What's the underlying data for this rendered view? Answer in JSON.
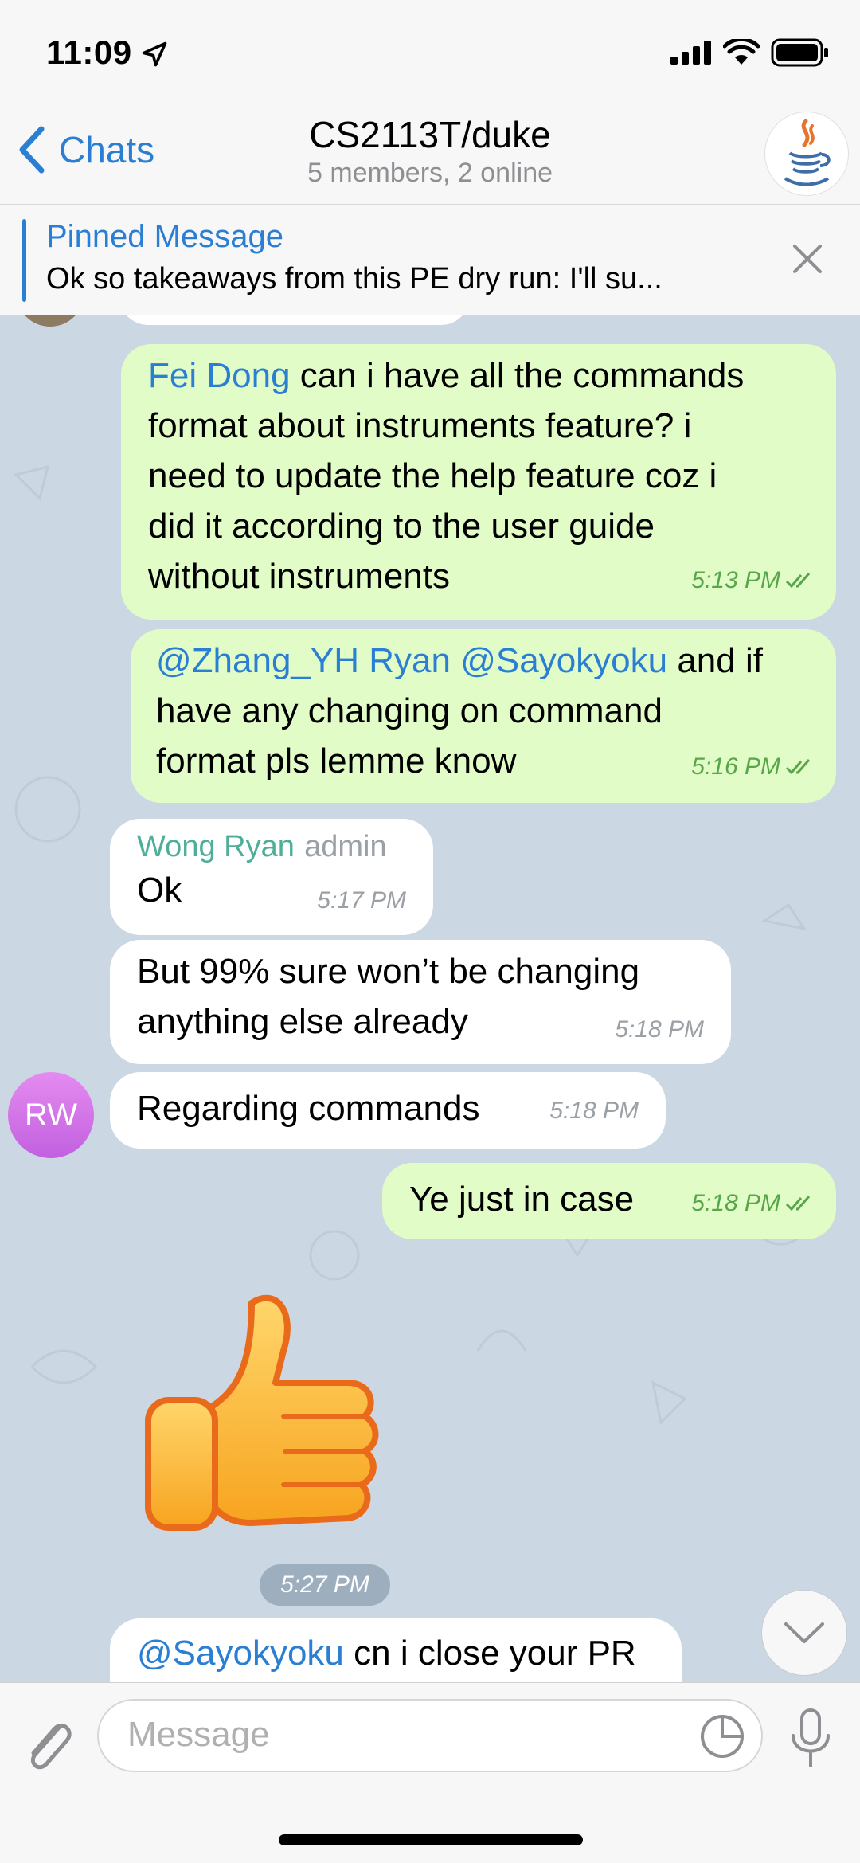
{
  "status_bar": {
    "time": "11:09"
  },
  "nav": {
    "back_label": "Chats",
    "title": "CS2113T/duke",
    "subtitle": "5 members, 2 online"
  },
  "pinned": {
    "title": "Pinned Message",
    "text": "Ok so takeaways from this PE dry run: I'll su..."
  },
  "messages": [
    {
      "direction": "out",
      "mention": "Fei Dong",
      "text_line1_rest": " can i have all the commands",
      "text_line2": "format about instruments feature? i",
      "text_line3": "need to update the help feature coz i",
      "text_line4": "did it according to the user guide",
      "text_line5": "without instruments",
      "time": "5:13 PM"
    },
    {
      "direction": "out",
      "mention1": "@Zhang_YH Ryan",
      "mention2": "@Sayokyoku",
      "text_line1_rest": " and if",
      "text_line2": "have any changing on command",
      "text_line3": "format pls lemme know",
      "time": "5:16 PM"
    },
    {
      "direction": "in",
      "sender": "Wong Ryan",
      "role": "admin",
      "text": "Ok",
      "time": "5:17 PM"
    },
    {
      "direction": "in",
      "text_line1": "But 99% sure won’t be changing",
      "text_line2": "anything else already",
      "time": "5:18 PM"
    },
    {
      "direction": "in",
      "text": "Regarding commands",
      "time": "5:18 PM"
    },
    {
      "direction": "out",
      "text": "Ye just in case",
      "time": "5:18 PM"
    },
    {
      "direction": "in",
      "sticker": "thumbs-up",
      "time": "5:27 PM"
    },
    {
      "direction": "in",
      "mention": "@Sayokyoku",
      "text_rest": " cn i close your PR"
    }
  ],
  "avatar_initials": "RW",
  "input": {
    "placeholder": "Message"
  },
  "colors": {
    "accent": "#2a7fd4",
    "outgoing_bubble": "#e2fcc8",
    "incoming_bubble": "#ffffff",
    "chat_background": "#cbd8e3",
    "sender_name": "#4fae9a"
  }
}
